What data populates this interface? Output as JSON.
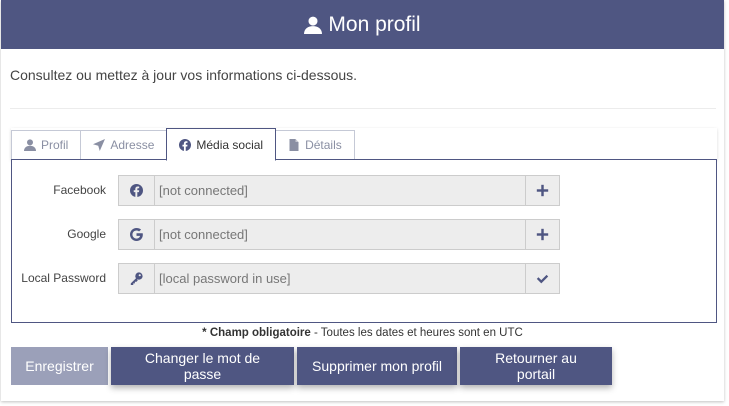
{
  "header": {
    "title": "Mon profil",
    "icon": "user-icon"
  },
  "intro": "Consultez ou mettez à jour vos informations ci-dessous.",
  "tabs": [
    {
      "label": "Profil",
      "icon": "user-icon",
      "active": false
    },
    {
      "label": "Adresse",
      "icon": "location-arrow-icon",
      "active": false
    },
    {
      "label": "Média social",
      "icon": "facebook-icon",
      "active": true
    },
    {
      "label": "Détails",
      "icon": "file-icon",
      "active": false
    }
  ],
  "social": [
    {
      "label": "Facebook",
      "icon": "facebook-icon",
      "value": "[not connected]",
      "action": "plus-icon"
    },
    {
      "label": "Google",
      "icon": "google-icon",
      "value": "[not connected]",
      "action": "plus-icon"
    },
    {
      "label": "Local Password",
      "icon": "key-icon",
      "value": "[local password in use]",
      "action": "check-icon"
    }
  ],
  "note": {
    "required": "* Champ obligatoire",
    "rest": " - Toutes les dates et heures sont en UTC"
  },
  "buttons": {
    "save": "Enregistrer",
    "change_password": "Changer le mot de passe",
    "delete_profile": "Supprimer mon profil",
    "back_portal": "Retourner au portail"
  },
  "colors": {
    "primary": "#4f5682",
    "disabled": "#9ba0b9",
    "field_bg": "#ededed"
  }
}
